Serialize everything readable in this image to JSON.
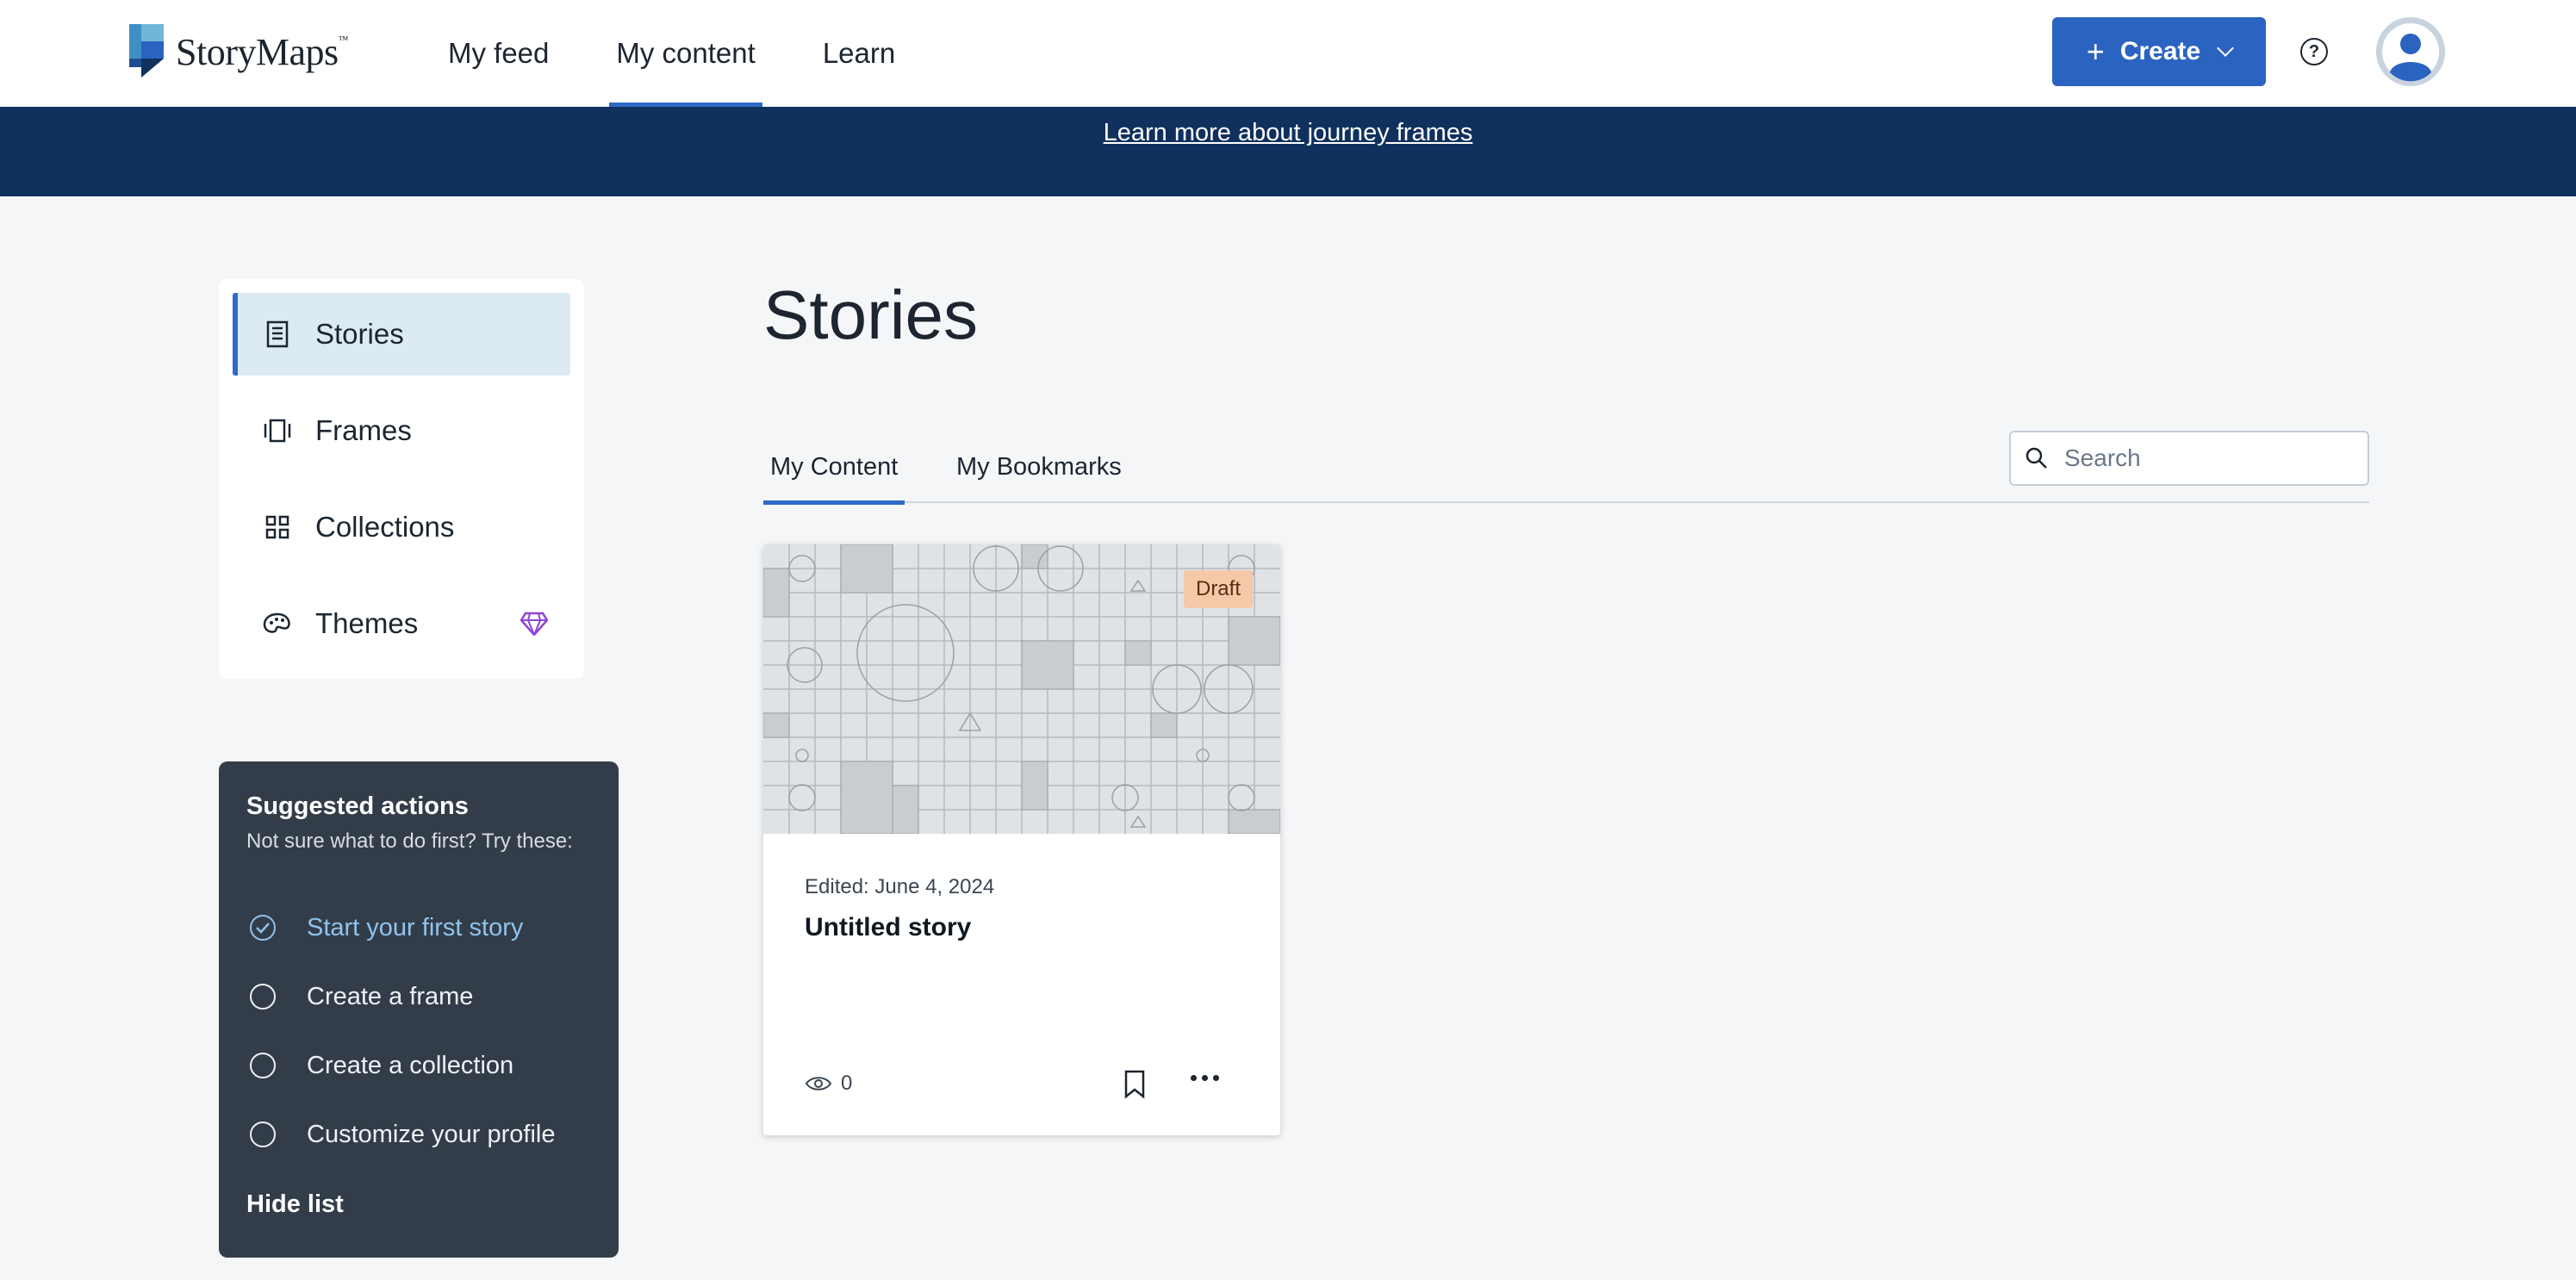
{
  "header": {
    "logo_text": "StoryMaps",
    "logo_tm": "™",
    "nav": [
      {
        "label": "My feed"
      },
      {
        "label": "My content"
      },
      {
        "label": "Learn"
      }
    ],
    "create_label": "Create",
    "help_icon": "help-circle-icon",
    "avatar_icon": "user-avatar-icon"
  },
  "banner": {
    "link_text": "Learn more about journey frames"
  },
  "sidebar": {
    "items": [
      {
        "label": "Stories",
        "icon": "story-icon"
      },
      {
        "label": "Frames",
        "icon": "frames-icon"
      },
      {
        "label": "Collections",
        "icon": "collections-grid-icon"
      },
      {
        "label": "Themes",
        "icon": "palette-icon",
        "badge_icon": "premium-gem-icon"
      }
    ]
  },
  "suggested": {
    "title": "Suggested actions",
    "subtitle": "Not sure what to do first? Try these:",
    "items": [
      {
        "label": "Start your first story",
        "done": true
      },
      {
        "label": "Create a frame",
        "done": false
      },
      {
        "label": "Create a collection",
        "done": false
      },
      {
        "label": "Customize your profile",
        "done": false
      }
    ],
    "hide_label": "Hide list"
  },
  "main": {
    "title": "Stories",
    "tabs": [
      {
        "label": "My Content"
      },
      {
        "label": "My Bookmarks"
      }
    ],
    "search_placeholder": "Search"
  },
  "card": {
    "badge": "Draft",
    "edited": "Edited: June 4, 2024",
    "title": "Untitled story",
    "views": "0"
  },
  "colors": {
    "accent": "#2b63c0",
    "banner": "#10315e",
    "sidebar_active": "#dbeaf3",
    "suggest_bg": "#333d49",
    "draft_badge": "#f5c8a8"
  }
}
